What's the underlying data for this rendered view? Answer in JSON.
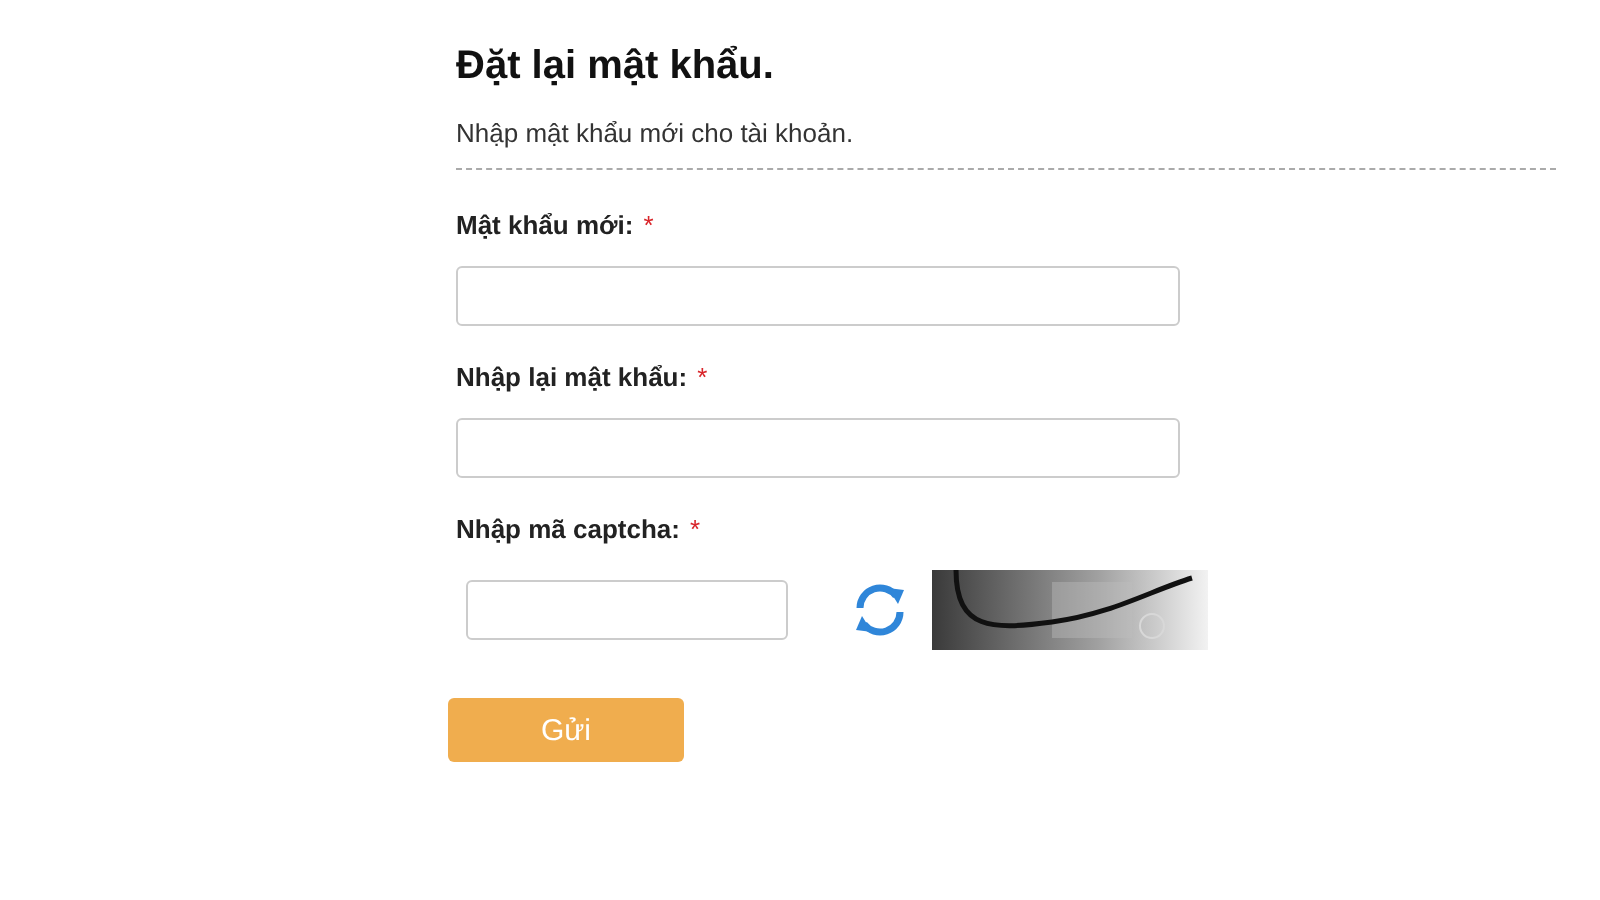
{
  "title": "Đặt lại mật khẩu.",
  "subtitle": "Nhập mật khẩu mới cho tài khoản.",
  "fields": [
    {
      "kind": "text",
      "label": "Mật khẩu mới:",
      "required_mark": "*"
    },
    {
      "kind": "text",
      "label": "Nhập lại mật khẩu:",
      "required_mark": "*"
    },
    {
      "kind": "captcha",
      "label": "Nhập mã captcha:",
      "required_mark": "*"
    }
  ],
  "submit": {
    "label": "Gửi"
  }
}
